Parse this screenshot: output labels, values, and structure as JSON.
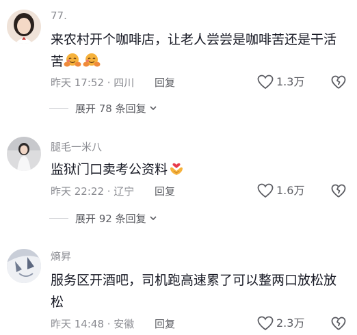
{
  "comments": [
    {
      "username": "77.",
      "text": "来农村开个咖啡店，让老人尝尝是咖啡苦还是干活苦",
      "emojis": [
        "hugging-face-emoji",
        "hugging-face-emoji"
      ],
      "time": "昨天 17:52 · 四川",
      "reply": "回复",
      "likes": "1.3万",
      "expand": "展开 78 条回复"
    },
    {
      "username": "腿毛一米八",
      "text": "监狱门口卖考公资料",
      "emojis": [
        "heart-hands-emoji"
      ],
      "time": "昨天 22:22 · 辽宁",
      "reply": "回复",
      "likes": "1.6万",
      "expand": "展开 92 条回复"
    },
    {
      "username": "熵昇",
      "text": "服务区开酒吧，司机跑高速累了可以整两口放松放松",
      "emojis": [],
      "time": "昨天 14:48 · 安徽",
      "reply": "回复",
      "likes": "2.3万"
    }
  ],
  "colors": {
    "text": "#161823",
    "meta": "#8a8b91",
    "emoji": "#f6b23c"
  }
}
